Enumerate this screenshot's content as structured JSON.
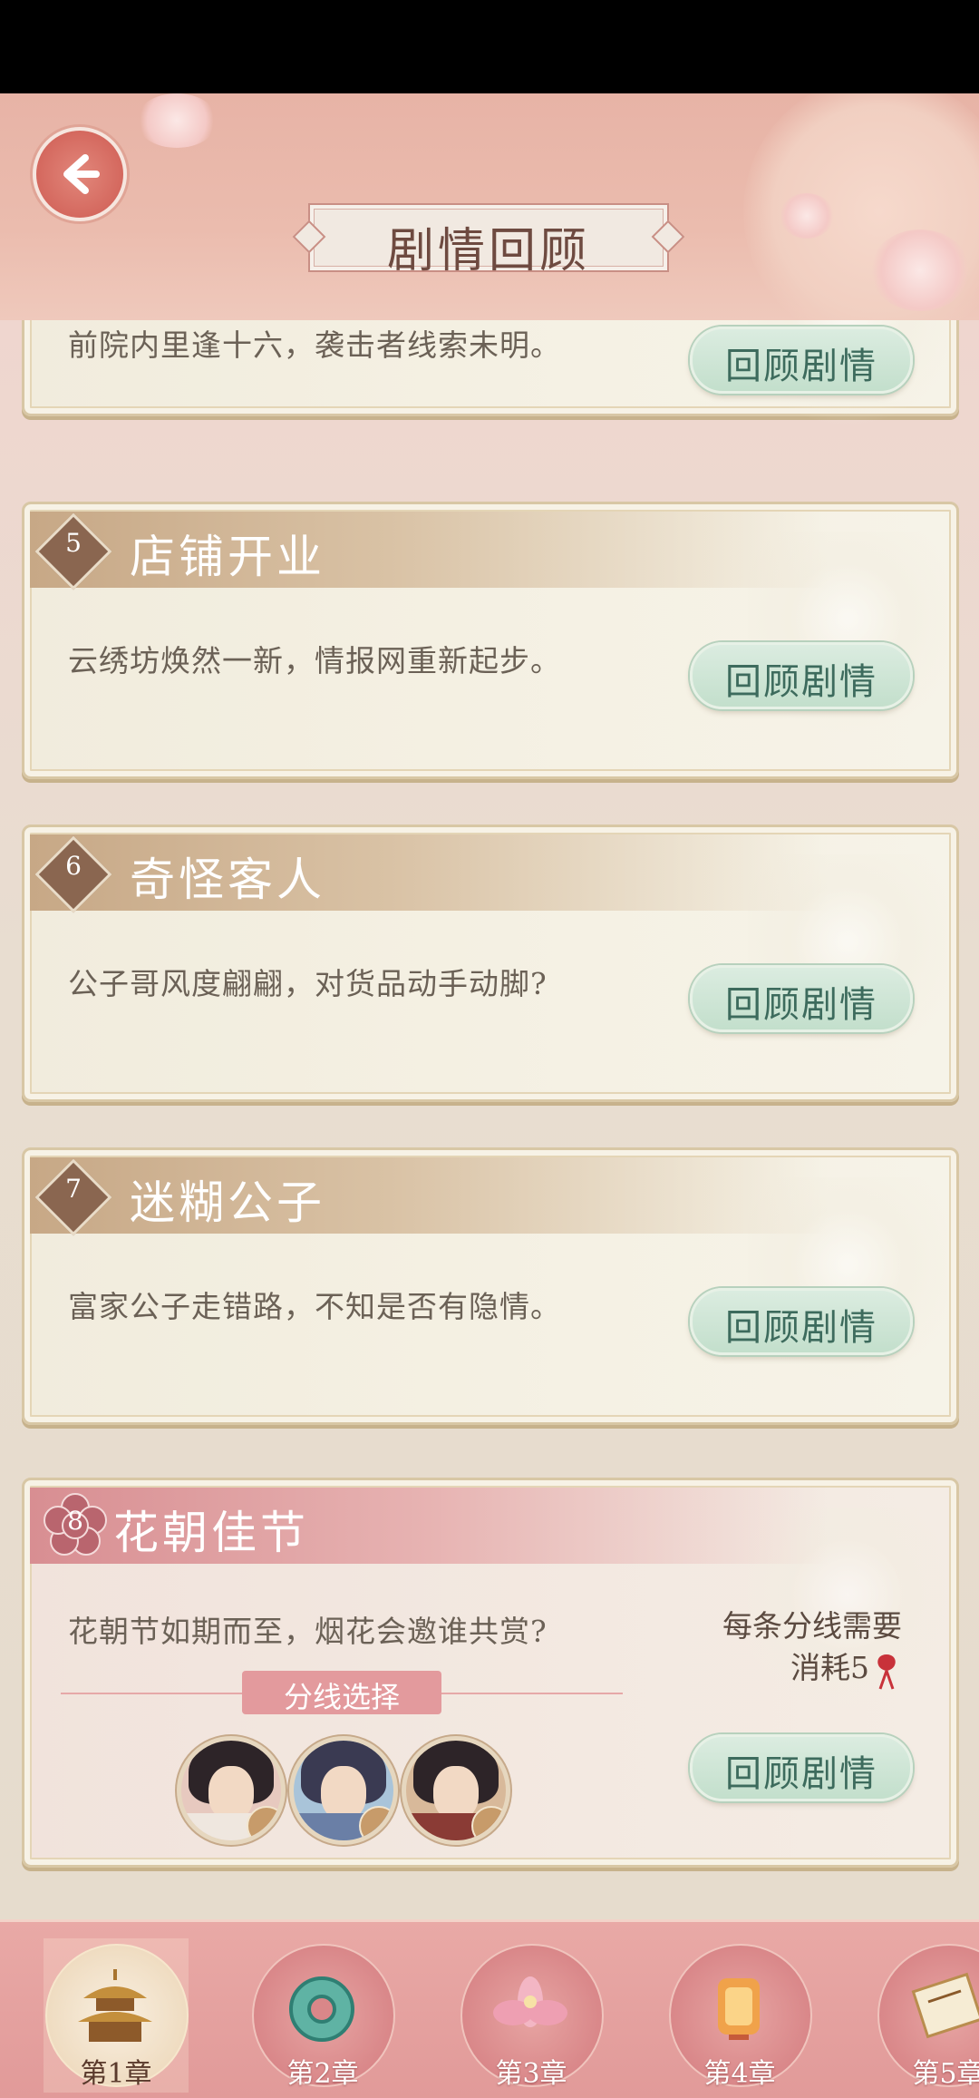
{
  "header": {
    "title": "剧情回顾"
  },
  "cards": [
    {
      "number": "",
      "title": "",
      "description": "前院内里逢十六，袭击者线索未明。",
      "button": "回顾剧情"
    },
    {
      "number": "5",
      "title": "店铺开业",
      "description": "云绣坊焕然一新，情报网重新起步。",
      "button": "回顾剧情"
    },
    {
      "number": "6",
      "title": "奇怪客人",
      "description": "公子哥风度翩翩，对货品动手动脚?",
      "button": "回顾剧情"
    },
    {
      "number": "7",
      "title": "迷糊公子",
      "description": "富家公子走错路，不知是否有隐情。",
      "button": "回顾剧情"
    },
    {
      "number": "8",
      "title": "花朝佳节",
      "description": "花朝节如期而至，烟花会邀谁共赏?",
      "button": "回顾剧情",
      "branch_label": "分线选择",
      "cost_line1": "每条分线需要",
      "cost_line2": "消耗5"
    }
  ],
  "tabs": [
    {
      "label": "第1章",
      "icon": "pavilion-icon",
      "active": true
    },
    {
      "label": "第2章",
      "icon": "jade-dragon-icon",
      "active": false
    },
    {
      "label": "第3章",
      "icon": "lotus-icon",
      "active": false
    },
    {
      "label": "第4章",
      "icon": "lantern-icon",
      "active": false
    },
    {
      "label": "第5章",
      "icon": "scroll-icon",
      "active": false
    }
  ],
  "colors": {
    "header_pink": "#e7b3a6",
    "card_title_bar": "#c7a886",
    "button_green": "#c3dfcc",
    "tabbar_pink": "#e19a99"
  }
}
